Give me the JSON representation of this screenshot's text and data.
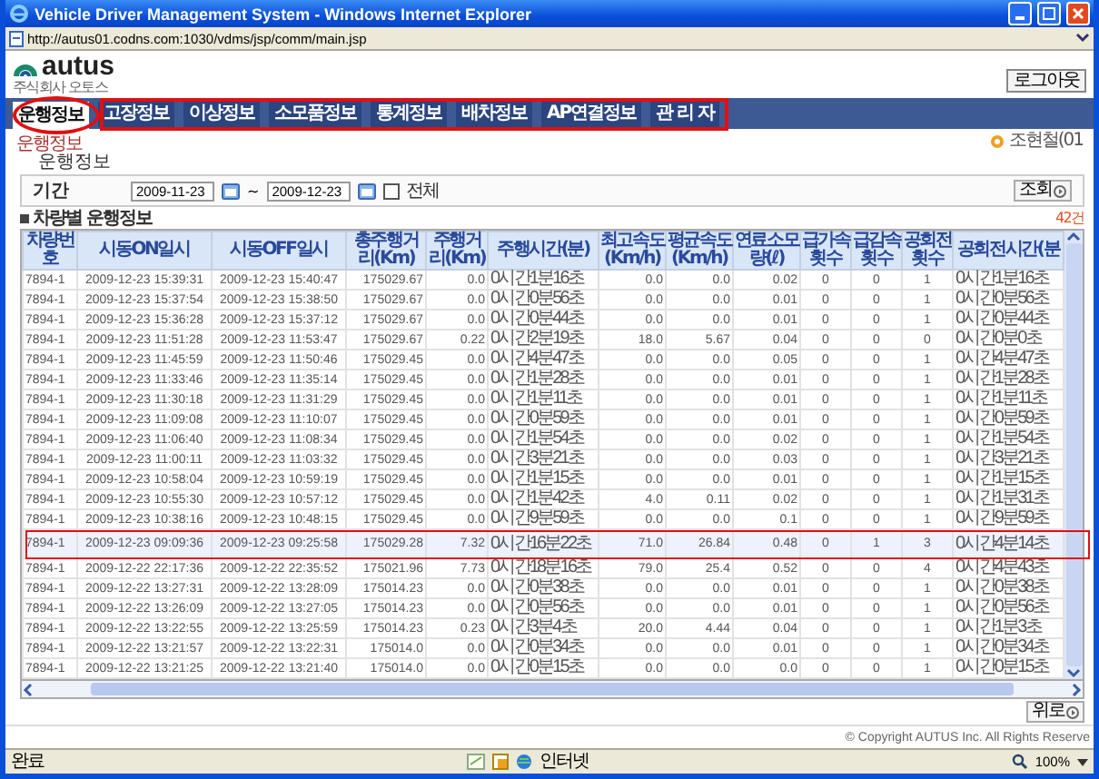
{
  "window": {
    "title": "Vehicle Driver Management System - Windows Internet Explorer"
  },
  "address": "http://autus01.codns.com:1030/vdms/jsp/comm/main.jsp",
  "logo": {
    "name": "autus",
    "subtitle": "주식회사 오토스"
  },
  "logout": "로그아웃",
  "tabs": [
    {
      "label": "운행정보",
      "selected": true,
      "circled": true
    },
    {
      "label": "고장정보",
      "selected": false,
      "boxed": true
    },
    {
      "label": "이상정보",
      "selected": false,
      "boxed": true
    },
    {
      "label": "소모품정보",
      "selected": false,
      "boxed": true
    },
    {
      "label": "통계정보",
      "selected": false,
      "boxed": true
    },
    {
      "label": "배차정보",
      "selected": false,
      "boxed": true
    },
    {
      "label": "AP연결정보",
      "selected": false,
      "boxed": true
    },
    {
      "label": "관 리 자",
      "selected": false,
      "boxed": true
    }
  ],
  "breadcrumb": "운행정보",
  "user": "조현철(01",
  "heading": "운행정보",
  "filter": {
    "label": "기간",
    "from": "2009-11-23",
    "separator": "~",
    "to": "2009-12-23",
    "all": {
      "label": "전체",
      "checked": false
    },
    "search_button": "조회"
  },
  "section": "차량별 운행정보",
  "count": "42건",
  "table": {
    "columns": [
      {
        "label": "차량번호",
        "kind": "code"
      },
      {
        "label": "시동ON일시",
        "kind": "datetime"
      },
      {
        "label": "시동OFF일시",
        "kind": "datetime"
      },
      {
        "label": "총주행거리(Km)",
        "kind": "number"
      },
      {
        "label": "주행거리(Km)",
        "kind": "number"
      },
      {
        "label": "주행시간(분)",
        "kind": "duration"
      },
      {
        "label": "최고속도(Km/h)",
        "kind": "number"
      },
      {
        "label": "평균속도(Km/h)",
        "kind": "number"
      },
      {
        "label": "연료소모량(ℓ)",
        "kind": "number"
      },
      {
        "label": "급가속횟수",
        "kind": "count"
      },
      {
        "label": "급감속횟수",
        "kind": "count"
      },
      {
        "label": "공회전횟수",
        "kind": "count"
      },
      {
        "label": "공회전시간(분",
        "kind": "duration"
      }
    ],
    "rows": [
      {
        "marked": false,
        "cells": [
          "7894-1",
          "2009-12-23 15:39:31",
          "2009-12-23 15:40:47",
          "175029.67",
          "0.0",
          "0시간1분16초",
          "0.0",
          "0.0",
          "0.02",
          "0",
          "0",
          "1",
          "0시간1분16초"
        ]
      },
      {
        "marked": false,
        "cells": [
          "7894-1",
          "2009-12-23 15:37:54",
          "2009-12-23 15:38:50",
          "175029.67",
          "0.0",
          "0시간0분56초",
          "0.0",
          "0.0",
          "0.01",
          "0",
          "0",
          "1",
          "0시간0분56초"
        ]
      },
      {
        "marked": false,
        "cells": [
          "7894-1",
          "2009-12-23 15:36:28",
          "2009-12-23 15:37:12",
          "175029.67",
          "0.0",
          "0시간0분44초",
          "0.0",
          "0.0",
          "0.01",
          "0",
          "0",
          "1",
          "0시간0분44초"
        ]
      },
      {
        "marked": false,
        "cells": [
          "7894-1",
          "2009-12-23 11:51:28",
          "2009-12-23 11:53:47",
          "175029.67",
          "0.22",
          "0시간2분19초",
          "18.0",
          "5.67",
          "0.04",
          "0",
          "0",
          "0",
          "0시간0분0초"
        ]
      },
      {
        "marked": false,
        "cells": [
          "7894-1",
          "2009-12-23 11:45:59",
          "2009-12-23 11:50:46",
          "175029.45",
          "0.0",
          "0시간4분47초",
          "0.0",
          "0.0",
          "0.05",
          "0",
          "0",
          "1",
          "0시간4분47초"
        ]
      },
      {
        "marked": false,
        "cells": [
          "7894-1",
          "2009-12-23 11:33:46",
          "2009-12-23 11:35:14",
          "175029.45",
          "0.0",
          "0시간1분28초",
          "0.0",
          "0.0",
          "0.01",
          "0",
          "0",
          "1",
          "0시간1분28초"
        ]
      },
      {
        "marked": false,
        "cells": [
          "7894-1",
          "2009-12-23 11:30:18",
          "2009-12-23 11:31:29",
          "175029.45",
          "0.0",
          "0시간1분11초",
          "0.0",
          "0.0",
          "0.01",
          "0",
          "0",
          "1",
          "0시간1분11초"
        ]
      },
      {
        "marked": false,
        "cells": [
          "7894-1",
          "2009-12-23 11:09:08",
          "2009-12-23 11:10:07",
          "175029.45",
          "0.0",
          "0시간0분59초",
          "0.0",
          "0.0",
          "0.01",
          "0",
          "0",
          "1",
          "0시간0분59초"
        ]
      },
      {
        "marked": false,
        "cells": [
          "7894-1",
          "2009-12-23 11:06:40",
          "2009-12-23 11:08:34",
          "175029.45",
          "0.0",
          "0시간1분54초",
          "0.0",
          "0.0",
          "0.02",
          "0",
          "0",
          "1",
          "0시간1분54초"
        ]
      },
      {
        "marked": false,
        "cells": [
          "7894-1",
          "2009-12-23 11:00:11",
          "2009-12-23 11:03:32",
          "175029.45",
          "0.0",
          "0시간3분21초",
          "0.0",
          "0.0",
          "0.03",
          "0",
          "0",
          "1",
          "0시간3분21초"
        ]
      },
      {
        "marked": false,
        "cells": [
          "7894-1",
          "2009-12-23 10:58:04",
          "2009-12-23 10:59:19",
          "175029.45",
          "0.0",
          "0시간1분15초",
          "0.0",
          "0.0",
          "0.01",
          "0",
          "0",
          "1",
          "0시간1분15초"
        ]
      },
      {
        "marked": false,
        "cells": [
          "7894-1",
          "2009-12-23 10:55:30",
          "2009-12-23 10:57:12",
          "175029.45",
          "0.0",
          "0시간1분42초",
          "4.0",
          "0.11",
          "0.02",
          "0",
          "0",
          "1",
          "0시간1분31초"
        ]
      },
      {
        "marked": false,
        "cells": [
          "7894-1",
          "2009-12-23 10:38:16",
          "2009-12-23 10:48:15",
          "175029.45",
          "0.0",
          "0시간9분59초",
          "0.0",
          "0.0",
          "0.1",
          "0",
          "0",
          "1",
          "0시간9분59초"
        ]
      },
      {
        "marked": true,
        "cells": [
          "7894-1",
          "2009-12-23 09:09:36",
          "2009-12-23 09:25:58",
          "175029.28",
          "7.32",
          "0시간16분22초",
          "71.0",
          "26.84",
          "0.48",
          "0",
          "1",
          "3",
          "0시간4분14초"
        ]
      },
      {
        "marked": false,
        "cells": [
          "7894-1",
          "2009-12-22 22:17:36",
          "2009-12-22 22:35:52",
          "175021.96",
          "7.73",
          "0시간18분16초",
          "79.0",
          "25.4",
          "0.52",
          "0",
          "0",
          "4",
          "0시간4분43초"
        ]
      },
      {
        "marked": false,
        "cells": [
          "7894-1",
          "2009-12-22 13:27:31",
          "2009-12-22 13:28:09",
          "175014.23",
          "0.0",
          "0시간0분38초",
          "0.0",
          "0.0",
          "0.01",
          "0",
          "0",
          "1",
          "0시간0분38초"
        ]
      },
      {
        "marked": false,
        "cells": [
          "7894-1",
          "2009-12-22 13:26:09",
          "2009-12-22 13:27:05",
          "175014.23",
          "0.0",
          "0시간0분56초",
          "0.0",
          "0.0",
          "0.01",
          "0",
          "0",
          "1",
          "0시간0분56초"
        ]
      },
      {
        "marked": false,
        "cells": [
          "7894-1",
          "2009-12-22 13:22:55",
          "2009-12-22 13:25:59",
          "175014.23",
          "0.23",
          "0시간3분4초",
          "20.0",
          "4.44",
          "0.04",
          "0",
          "0",
          "1",
          "0시간1분3초"
        ]
      },
      {
        "marked": false,
        "cells": [
          "7894-1",
          "2009-12-22 13:21:57",
          "2009-12-22 13:22:31",
          "175014.0",
          "0.0",
          "0시간0분34초",
          "0.0",
          "0.0",
          "0.01",
          "0",
          "0",
          "1",
          "0시간0분34초"
        ]
      },
      {
        "marked": false,
        "cells": [
          "7894-1",
          "2009-12-22 13:21:25",
          "2009-12-22 13:21:40",
          "175014.0",
          "0.0",
          "0시간0분15초",
          "0.0",
          "0.0",
          "0.0",
          "0",
          "0",
          "1",
          "0시간0분15초"
        ]
      }
    ]
  },
  "top_button": "위로",
  "copyright": "© Copyright AUTUS Inc. All Rights Reserve",
  "status_bar": {
    "text": "완료",
    "zone": "인터넷",
    "zoom": "100%"
  }
}
